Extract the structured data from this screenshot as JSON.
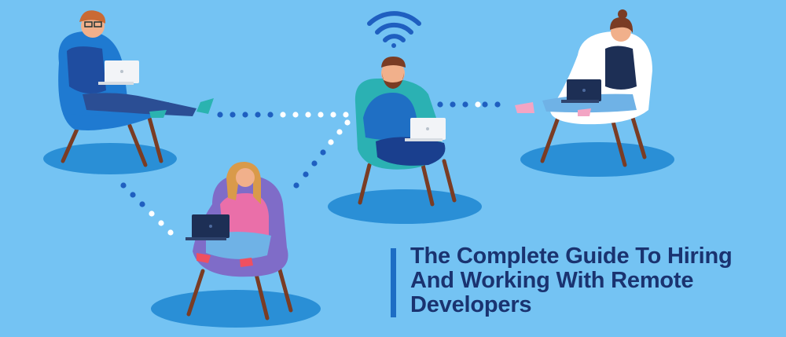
{
  "title": "The Complete Guide To Hiring And Working With Remote Developers",
  "colors": {
    "background": "#74c3f3",
    "accent_bar": "#1d6dc4",
    "title_text": "#1a3370",
    "chair_shadow": "#2a8fd6",
    "wifi": "#1f5fc0"
  },
  "icons": [
    "wifi-icon",
    "laptop-icon"
  ]
}
